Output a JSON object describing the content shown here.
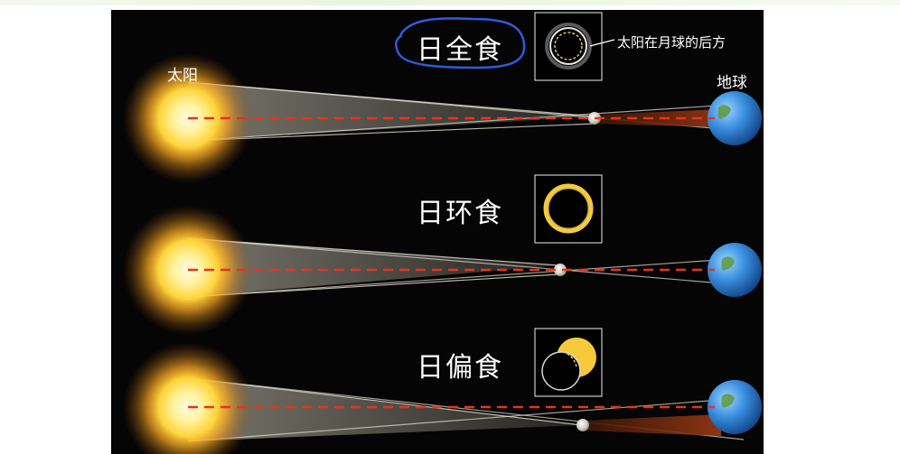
{
  "labels": {
    "sun": "太阳",
    "earth": "地球",
    "behind_note": "太阳在月球的后方"
  },
  "eclipses": {
    "total": "日全食",
    "annular": "日环食",
    "partial": "日偏食"
  },
  "colors": {
    "background": "#050505",
    "sun_core": "#fff6b0",
    "sun_glow": "#f7b733",
    "annotation_circle": "#2f5bd8",
    "reference_line": "#e8331f",
    "light_cone": "#d9d6c8",
    "umbra": "#7a2a10"
  },
  "icons": [
    "sun-icon",
    "moon-icon",
    "earth-icon",
    "eclipse-symbol-icon"
  ]
}
